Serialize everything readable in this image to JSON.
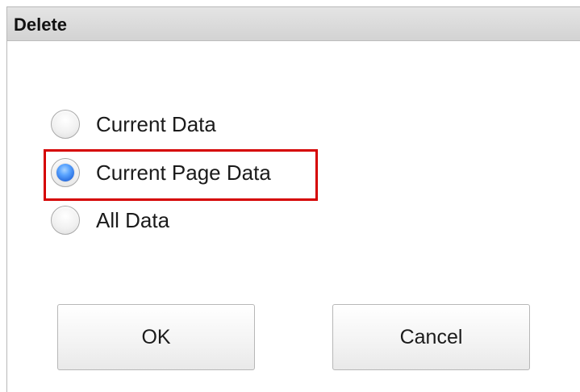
{
  "dialog": {
    "title": "Delete",
    "options": [
      {
        "label": "Current Data",
        "selected": false
      },
      {
        "label": "Current Page Data",
        "selected": true
      },
      {
        "label": "All Data",
        "selected": false
      }
    ],
    "buttons": {
      "ok_label": "OK",
      "cancel_label": "Cancel"
    }
  },
  "colors": {
    "highlight_border": "#d50000",
    "radio_selected": "#2b6fe0",
    "titlebar_bg": "#d9d9d9"
  }
}
